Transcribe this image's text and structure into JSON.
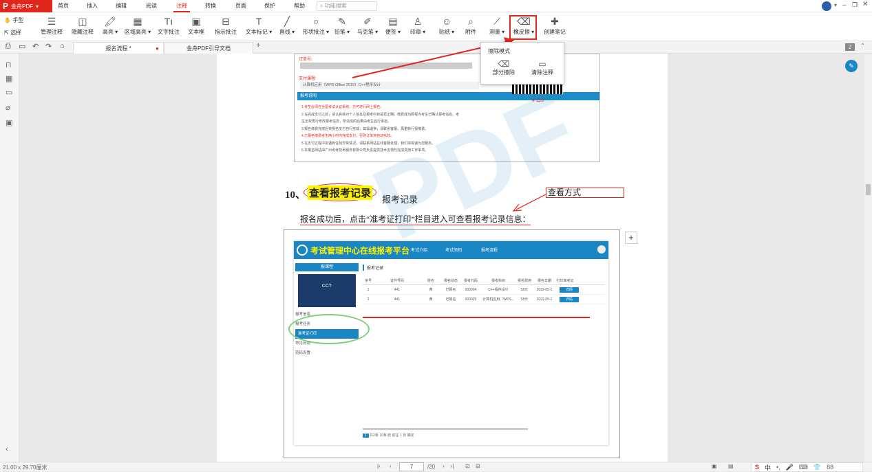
{
  "brand": {
    "name": "金舟PDF",
    "logo": "P"
  },
  "menus": [
    {
      "label": "首页"
    },
    {
      "label": "插入"
    },
    {
      "label": "编辑"
    },
    {
      "label": "阅读"
    },
    {
      "label": "注释",
      "active": true
    },
    {
      "label": "转换"
    },
    {
      "label": "页面"
    },
    {
      "label": "保护"
    },
    {
      "label": "帮助"
    }
  ],
  "search": {
    "placeholder": "功能搜索"
  },
  "tools_left": {
    "hand": "手型",
    "select": "选择"
  },
  "toolbar": [
    {
      "label": "管理注释",
      "icon": "manage-annotations-icon",
      "glyph": "☰"
    },
    {
      "label": "隐藏注释",
      "icon": "hide-annotations-icon",
      "glyph": "◫"
    },
    {
      "label": "高亮 ▾",
      "icon": "highlight-icon",
      "glyph": "🖍"
    },
    {
      "label": "区域高亮 ▾",
      "icon": "area-highlight-icon",
      "glyph": "▦"
    },
    {
      "label": "文字批注",
      "icon": "text-comment-icon",
      "glyph": "Tı"
    },
    {
      "label": "文本框",
      "icon": "text-box-icon",
      "glyph": "▣"
    },
    {
      "label": "指示批注",
      "icon": "callout-icon",
      "glyph": "⊟"
    },
    {
      "label": "文本标记 ▾",
      "icon": "text-mark-icon",
      "glyph": "T"
    },
    {
      "label": "直线 ▾",
      "icon": "line-icon",
      "glyph": "╱"
    },
    {
      "label": "形状批注 ▾",
      "icon": "shape-icon",
      "glyph": "○"
    },
    {
      "label": "铅笔 ▾",
      "icon": "pencil-icon",
      "glyph": "✎"
    },
    {
      "label": "马克笔 ▾",
      "icon": "marker-icon",
      "glyph": "✐"
    },
    {
      "label": "便签 ▾",
      "icon": "sticky-note-icon",
      "glyph": "▤"
    },
    {
      "label": "印章 ▾",
      "icon": "stamp-icon",
      "glyph": "♙"
    },
    {
      "label": "贴纸 ▾",
      "icon": "sticker-icon",
      "glyph": "☺"
    },
    {
      "label": "附件",
      "icon": "attachment-icon",
      "glyph": "⌕"
    },
    {
      "label": "测量 ▾",
      "icon": "measure-icon",
      "glyph": "⟋"
    },
    {
      "label": "橡皮擦 ▾",
      "icon": "eraser-icon",
      "glyph": "⌫"
    },
    {
      "label": "创建笔记",
      "icon": "create-note-icon",
      "glyph": "✚"
    }
  ],
  "quick_icons": [
    "print-icon",
    "save-icon",
    "undo-icon",
    "redo-icon",
    "home-icon"
  ],
  "tabs": [
    {
      "label": "报名流程 *"
    },
    {
      "label": "金舟PDF引导文档"
    }
  ],
  "tab_add": "+",
  "page_count_badge": "2",
  "eraser_menu": {
    "title": "擦除模式",
    "partial": "部分擦除",
    "clear": "清除注释"
  },
  "doc": {
    "order_no_label": "订单号:",
    "course_label": "支付课程:",
    "course_value": "计算机应用（WPS Office 2019）C++程序设计",
    "notes_title": "报考说明",
    "notes": [
      "1.考生必须在全国考试认证系统，方可进行网上报名。",
      "2.在完成支付之前，请认真核对个人信息及报考科目是否正确，缴费成功即视为考生已确认报考信息。考",
      "生无权再行修改报考信息，所造成的后果由考生自行承担。",
      "3.报名缴费完成后将报名支付自行完成，如需退换，请联系客服。再重新行报缴费。",
      "4.已报名缴费考生两小时内完成支付，否则订单将自动失效。",
      "5.在支付过程中如遇到任何异常情况，请联系网站在线客服处理，我们将竭诚为您服务。",
      "6.本报名网站由广州考考技术服务有限公司负责提供技术支持与完成费用工作事项。"
    ],
    "price": "¥ 116",
    "heading_num": "10、",
    "heading": "查看报考记录",
    "annot_text": "报考记录",
    "annot_box": "查看方式",
    "body_text": "报名成功后，点击“准考证打印”栏目进入可查看报考记录信息："
  },
  "web": {
    "title": "考试管理中心在线报考平台",
    "nav": [
      "考试介绍",
      "考试须知",
      "报考流程"
    ],
    "side_title": "报课程",
    "side_items": [
      "报考信息",
      "报考任务",
      "准考证打印",
      "常见问题",
      "密码设置"
    ],
    "section": "报考记录",
    "cols": [
      "序号",
      "证件号码",
      "姓名",
      "报名状态",
      "报考代码",
      "报考科目",
      "报名费用",
      "报名日期",
      "打印准考证"
    ],
    "rows": [
      [
        "1",
        "441",
        "黄",
        "已报名",
        "000004",
        "C++程序设计",
        "58元",
        "2022-05-1",
        "详情"
      ],
      [
        "2",
        "441",
        "黄",
        "已报名",
        "000025",
        "计算机应用（WPS...",
        "58元",
        "2022-05-1",
        "详情"
      ]
    ],
    "pager": "共2条  10条/页  前往  1  页  确定"
  },
  "status": {
    "dims": "21.00 x 29.70厘米",
    "page_input": "7",
    "page_total": "/20"
  },
  "ime": [
    "S",
    "中",
    "•,",
    "🎤",
    "⌨",
    "👕",
    "88"
  ]
}
